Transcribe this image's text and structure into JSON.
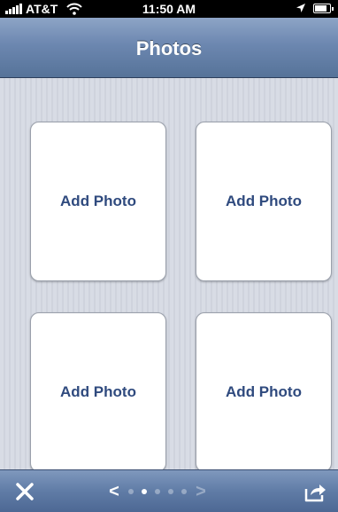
{
  "status_bar": {
    "carrier": "AT&T",
    "time": "11:50 AM",
    "battery_level": 0.85
  },
  "nav": {
    "title": "Photos"
  },
  "tiles": [
    {
      "label": "Add Photo"
    },
    {
      "label": "Add Photo"
    },
    {
      "label": "Add Photo"
    },
    {
      "label": "Add Photo"
    }
  ],
  "toolbar": {
    "prev": "<",
    "next": ">",
    "page_count": 5,
    "current_page": 2
  },
  "colors": {
    "accent_text": "#2f4a7e",
    "nav_bar": "#6c87b0"
  }
}
